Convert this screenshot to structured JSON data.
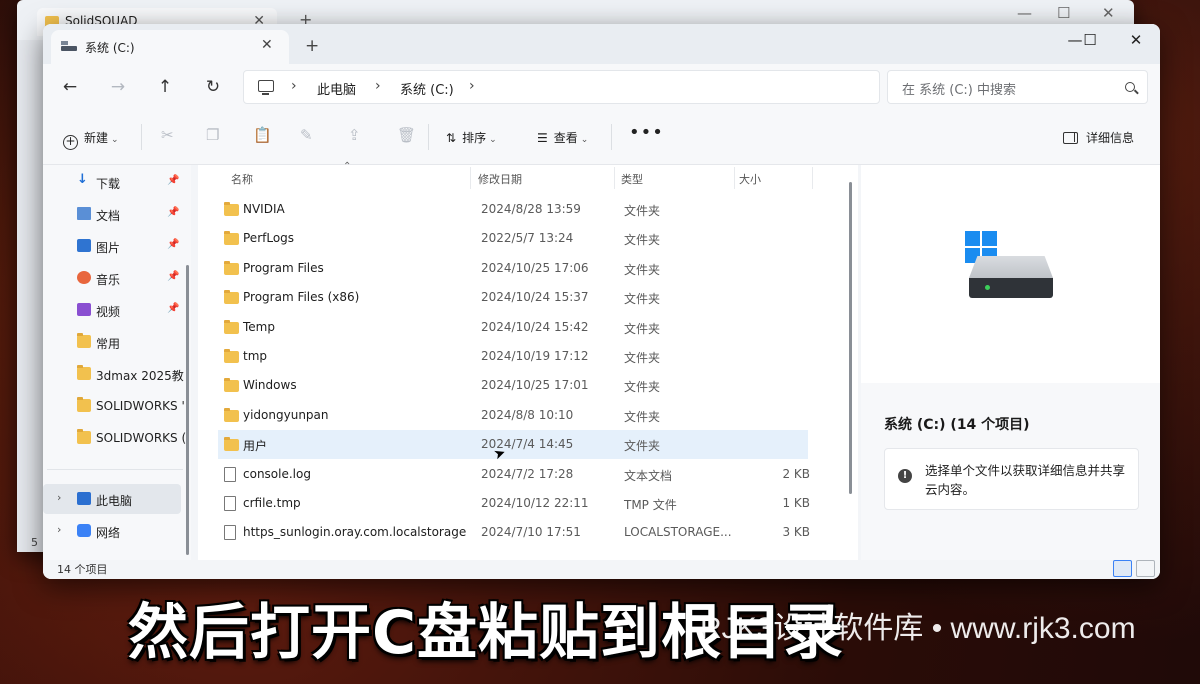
{
  "back_window": {
    "tab_title": "SolidSQUAD",
    "status": "5"
  },
  "window": {
    "tab_title": "系统 (C:)",
    "new_tab": "+",
    "controls": {
      "minimize": "—",
      "maximize": "☐",
      "close": "✕"
    }
  },
  "nav": {
    "back": "←",
    "forward": "→",
    "up": "↑",
    "refresh": "↻",
    "breadcrumbs": [
      "此电脑",
      "系统 (C:)"
    ],
    "search_placeholder": "在 系统 (C:) 中搜索"
  },
  "toolbar": {
    "new_label": "新建",
    "sort_label": "排序",
    "view_label": "查看",
    "more_label": "•••",
    "details_label": "详细信息"
  },
  "sidebar": {
    "quick": [
      {
        "label": "下载",
        "icon": "download-icon"
      },
      {
        "label": "文档",
        "icon": "document-icon"
      },
      {
        "label": "图片",
        "icon": "pictures-icon"
      },
      {
        "label": "音乐",
        "icon": "music-icon"
      },
      {
        "label": "视频",
        "icon": "video-icon"
      },
      {
        "label": "常用",
        "icon": "folder-icon"
      },
      {
        "label": "3dmax 2025教",
        "icon": "folder-icon"
      },
      {
        "label": "SOLIDWORKS '",
        "icon": "folder-icon"
      },
      {
        "label": "SOLIDWORKS (",
        "icon": "folder-icon"
      }
    ],
    "this_pc": "此电脑",
    "network": "网络"
  },
  "columns": {
    "name": "名称",
    "date": "修改日期",
    "type": "类型",
    "size": "大小"
  },
  "files": [
    {
      "name": "NVIDIA",
      "date": "2024/8/28 13:59",
      "type": "文件夹",
      "size": "",
      "kind": "folder"
    },
    {
      "name": "PerfLogs",
      "date": "2022/5/7 13:24",
      "type": "文件夹",
      "size": "",
      "kind": "folder"
    },
    {
      "name": "Program Files",
      "date": "2024/10/25 17:06",
      "type": "文件夹",
      "size": "",
      "kind": "folder"
    },
    {
      "name": "Program Files (x86)",
      "date": "2024/10/24 15:37",
      "type": "文件夹",
      "size": "",
      "kind": "folder"
    },
    {
      "name": "Temp",
      "date": "2024/10/24 15:42",
      "type": "文件夹",
      "size": "",
      "kind": "folder"
    },
    {
      "name": "tmp",
      "date": "2024/10/19 17:12",
      "type": "文件夹",
      "size": "",
      "kind": "folder"
    },
    {
      "name": "Windows",
      "date": "2024/10/25 17:01",
      "type": "文件夹",
      "size": "",
      "kind": "folder"
    },
    {
      "name": "yidongyunpan",
      "date": "2024/8/8 10:10",
      "type": "文件夹",
      "size": "",
      "kind": "folder"
    },
    {
      "name": "用户",
      "date": "2024/7/4 14:45",
      "type": "文件夹",
      "size": "",
      "kind": "folder"
    },
    {
      "name": "console.log",
      "date": "2024/7/2 17:28",
      "type": "文本文档",
      "size": "2 KB",
      "kind": "file"
    },
    {
      "name": "crfile.tmp",
      "date": "2024/10/12 22:11",
      "type": "TMP 文件",
      "size": "1 KB",
      "kind": "file"
    },
    {
      "name": "https_sunlogin.oray.com.localstorage",
      "date": "2024/7/10 17:51",
      "type": "LOCALSTORAGE...",
      "size": "3 KB",
      "kind": "file"
    }
  ],
  "selected_index": 8,
  "details": {
    "title": "系统 (C:) (14 个项目)",
    "info": "选择单个文件以获取详细信息并共享云内容。"
  },
  "status": {
    "count": "14 个项目"
  },
  "caption": "然后打开C盘粘贴到根目录",
  "watermark": "RJK3设计软件库 • www.rjk3.com",
  "colors": {
    "accent": "#1a8cf0",
    "folder": "#f2c14e",
    "selection": "#e5f0fb"
  }
}
